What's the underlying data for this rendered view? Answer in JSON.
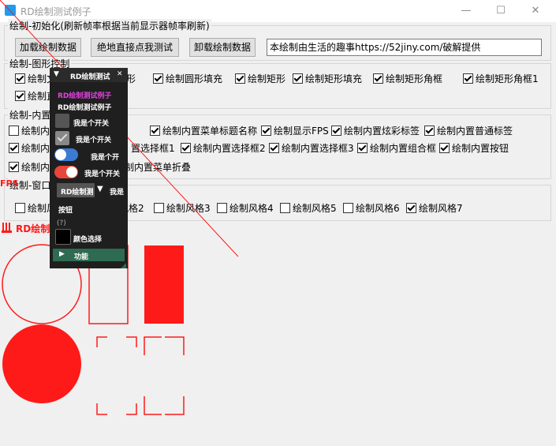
{
  "window": {
    "title": "RD绘制测试例子",
    "minimize": "—",
    "maximize": "☐",
    "close": "✕"
  },
  "init_group": {
    "label": "绘制-初始化(刷新帧率根据当前显示器帧率刷新)",
    "load_button": "加载绘制数据",
    "test_button": "绝地直接点我测试",
    "unload_button": "卸载绘制数据",
    "info_text": "本绘制由生活的趣事https://52jiny.com/破解提供"
  },
  "shape_group": {
    "label": "绘制-图形控制",
    "items": [
      {
        "label": "绘制文",
        "checked": true
      },
      {
        "label": "形",
        "checked": false
      },
      {
        "label": "绘制圆形填充",
        "checked": true
      },
      {
        "label": "绘制矩形",
        "checked": true
      },
      {
        "label": "绘制矩形填充",
        "checked": true
      },
      {
        "label": "绘制矩形角框",
        "checked": true
      },
      {
        "label": "绘制矩形角框1",
        "checked": true
      },
      {
        "label": "绘制直",
        "checked": true
      }
    ]
  },
  "builtin_group": {
    "label": "绘制-内置",
    "items": [
      {
        "label": "绘制内",
        "checked": false
      },
      {
        "label": "绘制内置菜单标题名称",
        "checked": true
      },
      {
        "label": "绘制显示FPS",
        "checked": true
      },
      {
        "label": "绘制内置炫彩标签",
        "checked": true
      },
      {
        "label": "绘制内置普通标签",
        "checked": true
      },
      {
        "label": "绘制内",
        "checked": true
      },
      {
        "label": "置选择框1",
        "checked": false
      },
      {
        "label": "绘制内置选择框2",
        "checked": true
      },
      {
        "label": "绘制内置选择框3",
        "checked": true
      },
      {
        "label": "绘制内置组合框",
        "checked": true
      },
      {
        "label": "绘制内置按钮",
        "checked": true
      },
      {
        "label": "绘制内",
        "checked": true
      },
      {
        "label": "制内置菜单折叠",
        "checked": false
      }
    ]
  },
  "window_group": {
    "label": "绘制-窗口",
    "items": [
      {
        "label": "绘制风",
        "checked": false
      },
      {
        "label": "绘制风格2",
        "checked": true
      },
      {
        "label": "绘制风格3",
        "checked": false
      },
      {
        "label": "绘制风格4",
        "checked": false
      },
      {
        "label": "绘制风格5",
        "checked": false
      },
      {
        "label": "绘制风格6",
        "checked": false
      },
      {
        "label": "绘制风格7",
        "checked": true
      }
    ]
  },
  "fps_label": "FPS",
  "canvas_label": "RD绘制",
  "overlay_menu": {
    "header": "RD绘制测试",
    "header_arrow": "▼",
    "close": "✕",
    "rainbow_label": "RD绘制测试例子",
    "normal_label": "RD绘制测试例子",
    "switch1": "我是个开关",
    "switch2": "我是个开关",
    "switch3": "我是个开",
    "switch4": "我是个开关",
    "combo": "RD绘制测",
    "combo_arrow": "▼",
    "combo_text": "我是",
    "button": "按钮",
    "help": "(?)",
    "color_label": "颜色选择",
    "section": "功能",
    "section_arrow": "▶"
  },
  "colors": {
    "accent_red": "#ff1a1a",
    "menu_bg": "#1f1f1f",
    "section_bg": "#2e6b52",
    "rainbow": "#e040e0",
    "toggle_red": "#e8463a",
    "toggle_blue": "#3a7bd5"
  }
}
